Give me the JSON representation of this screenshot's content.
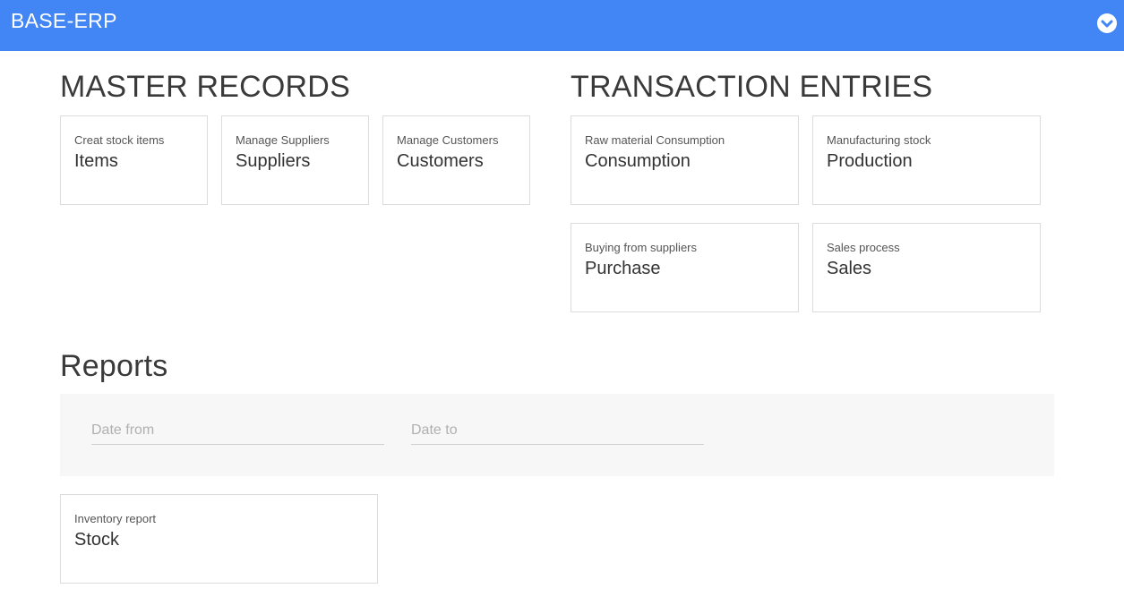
{
  "header": {
    "app_title": "BASE-ERP",
    "menu_icon": "chevron-down-circle-icon",
    "accent_color": "#4285f4"
  },
  "master": {
    "heading": "MASTER RECORDS",
    "cards": [
      {
        "subtitle": "Creat stock items",
        "title": "Items"
      },
      {
        "subtitle": "Manage Suppliers",
        "title": "Suppliers"
      },
      {
        "subtitle": "Manage Customers",
        "title": "Customers"
      }
    ]
  },
  "transactions": {
    "heading": "TRANSACTION ENTRIES",
    "cards": [
      {
        "subtitle": "Raw material Consumption",
        "title": "Consumption"
      },
      {
        "subtitle": "Manufacturing stock",
        "title": "Production"
      },
      {
        "subtitle": "Buying from suppliers",
        "title": "Purchase"
      },
      {
        "subtitle": "Sales process",
        "title": "Sales"
      }
    ]
  },
  "reports": {
    "heading": "Reports",
    "date_from": {
      "placeholder": "Date from",
      "value": ""
    },
    "date_to": {
      "placeholder": "Date to",
      "value": ""
    },
    "cards": [
      {
        "subtitle": "Inventory report",
        "title": "Stock"
      }
    ]
  }
}
